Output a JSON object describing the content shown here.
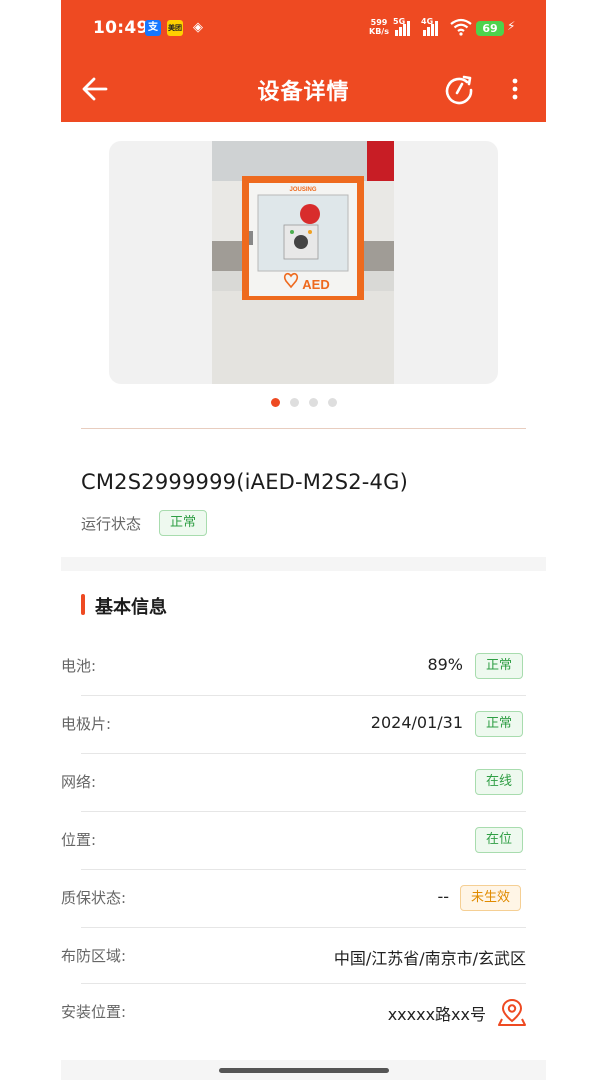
{
  "status_bar": {
    "time": "10:49",
    "app_icons": [
      "alipay-icon",
      "meituan-icon",
      "settings-icon"
    ],
    "app_icon_text": [
      "支",
      "美团",
      "◈"
    ],
    "speed_value": "599",
    "speed_unit": "KB/s",
    "net1": "5G",
    "net2": "4G",
    "battery": "69"
  },
  "header": {
    "title": "设备详情",
    "background_color": "#ee4a22"
  },
  "carousel": {
    "image_label": "AED",
    "brand_text": "JOUSING",
    "page_count": 4,
    "active_index": 0
  },
  "device": {
    "name": "CM2S2999999(iAED-M2S2-4G)",
    "run_status_label": "运行状态",
    "run_status": "正常"
  },
  "basic_info": {
    "title": "基本信息",
    "rows": [
      {
        "label": "电池:",
        "value": "89%",
        "badge": "正常"
      },
      {
        "label": "电极片:",
        "value": "2024/01/31",
        "badge": "正常"
      },
      {
        "label": "网络:",
        "value": "",
        "badge": "在线"
      },
      {
        "label": "位置:",
        "value": "",
        "badge": "在位"
      },
      {
        "label": "质保状态:",
        "value": "--",
        "badge": "未生效"
      },
      {
        "label": "布防区域:",
        "value": "中国/江苏省/南京市/玄武区"
      },
      {
        "label": "安装位置:",
        "value": "xxxxx路xx号"
      }
    ]
  },
  "colors": {
    "accent": "#ee4a22",
    "ok_green": "#2f9e44",
    "warn_orange": "#e08b00"
  }
}
